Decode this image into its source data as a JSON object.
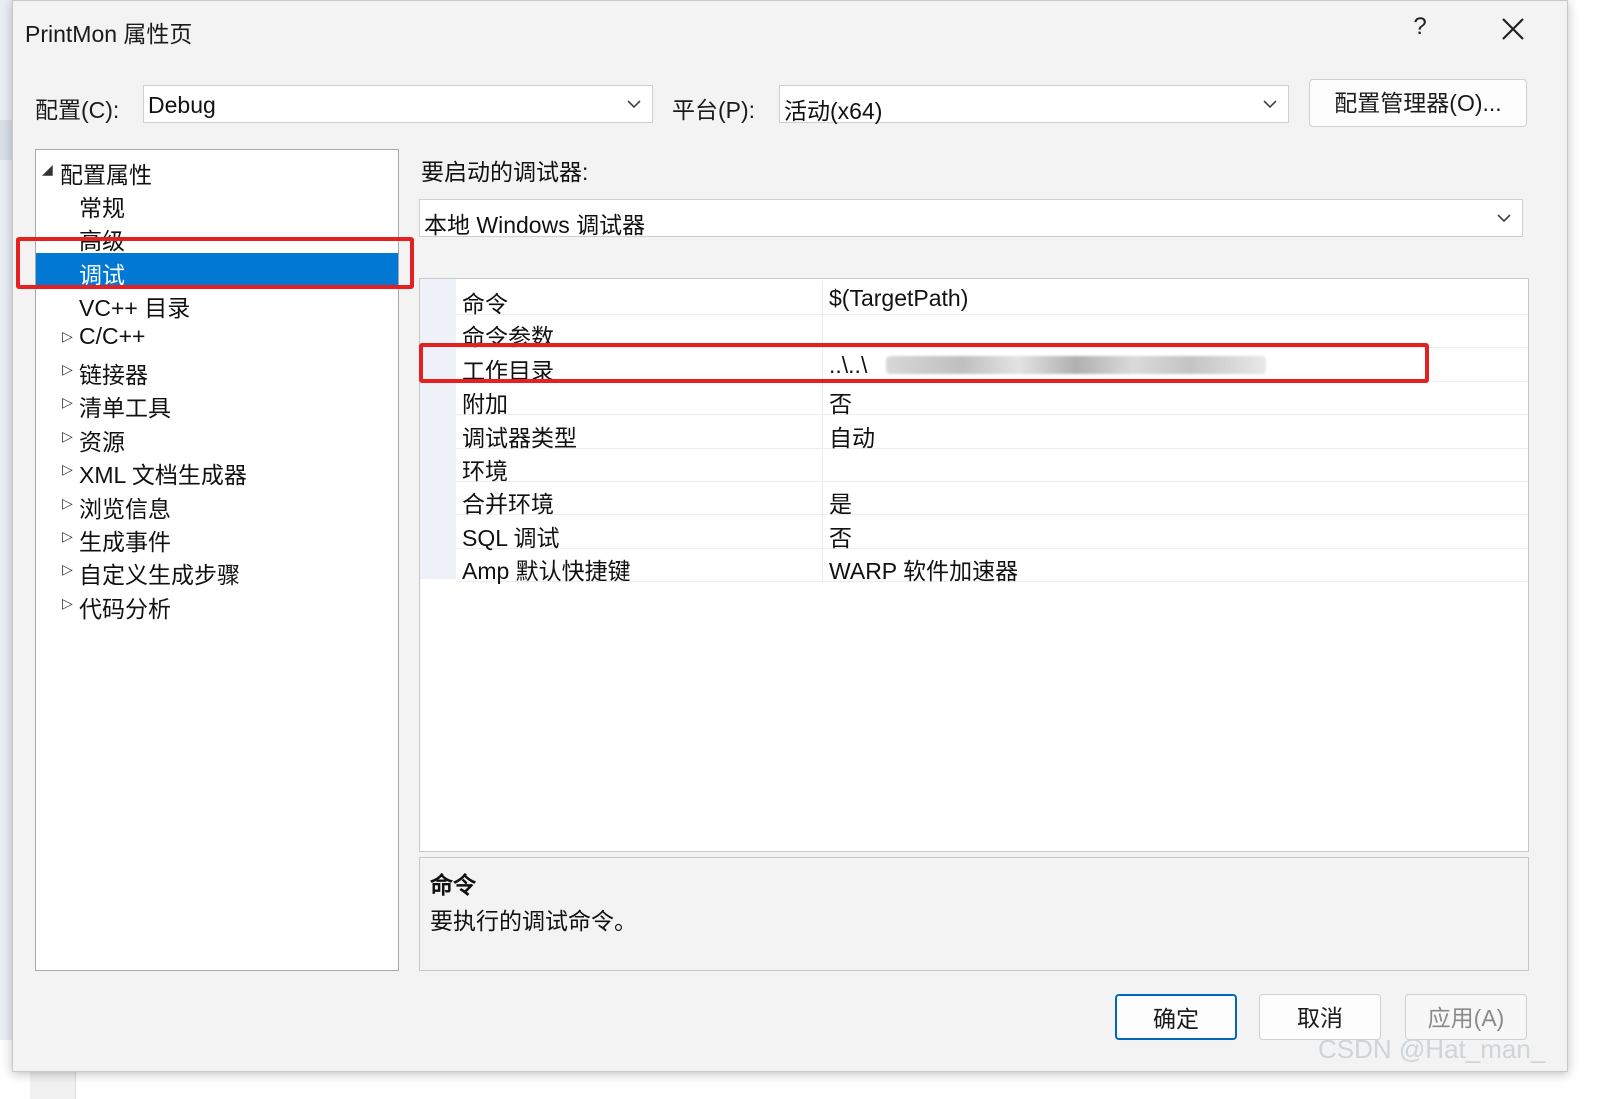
{
  "window": {
    "title": "PrintMon 属性页",
    "help_label": "?",
    "close_icon": "close-icon"
  },
  "toolbar": {
    "config_label": "配置(C):",
    "config_value": "Debug",
    "platform_label": "平台(P):",
    "platform_value": "活动(x64)",
    "config_manager_label": "配置管理器(O)..."
  },
  "tree": {
    "root_label": "配置属性",
    "items": [
      {
        "label": "常规",
        "expandable": false,
        "selected": false
      },
      {
        "label": "高级",
        "expandable": false,
        "selected": false
      },
      {
        "label": "调试",
        "expandable": false,
        "selected": true
      },
      {
        "label": "VC++ 目录",
        "expandable": false,
        "selected": false
      },
      {
        "label": "C/C++",
        "expandable": true,
        "selected": false
      },
      {
        "label": "链接器",
        "expandable": true,
        "selected": false
      },
      {
        "label": "清单工具",
        "expandable": true,
        "selected": false
      },
      {
        "label": "资源",
        "expandable": true,
        "selected": false
      },
      {
        "label": "XML 文档生成器",
        "expandable": true,
        "selected": false
      },
      {
        "label": "浏览信息",
        "expandable": true,
        "selected": false
      },
      {
        "label": "生成事件",
        "expandable": true,
        "selected": false
      },
      {
        "label": "自定义生成步骤",
        "expandable": true,
        "selected": false
      },
      {
        "label": "代码分析",
        "expandable": true,
        "selected": false
      }
    ]
  },
  "debugger": {
    "label": "要启动的调试器:",
    "value": "本地 Windows 调试器"
  },
  "properties": [
    {
      "name": "命令",
      "value": "$(TargetPath)"
    },
    {
      "name": "命令参数",
      "value": ""
    },
    {
      "name": "工作目录",
      "value": "..\\..\\"
    },
    {
      "name": "附加",
      "value": "否"
    },
    {
      "name": "调试器类型",
      "value": "自动"
    },
    {
      "name": "环境",
      "value": ""
    },
    {
      "name": "合并环境",
      "value": "是"
    },
    {
      "name": "SQL 调试",
      "value": "否"
    },
    {
      "name": "Amp 默认快捷键",
      "value": "WARP 软件加速器"
    }
  ],
  "description": {
    "heading": "命令",
    "text": "要执行的调试命令。"
  },
  "buttons": {
    "ok": "确定",
    "cancel": "取消",
    "apply": "应用(A)"
  },
  "watermark": "CSDN @Hat_man_",
  "colors": {
    "selection": "#0078d4",
    "highlight_box": "#e52020"
  }
}
